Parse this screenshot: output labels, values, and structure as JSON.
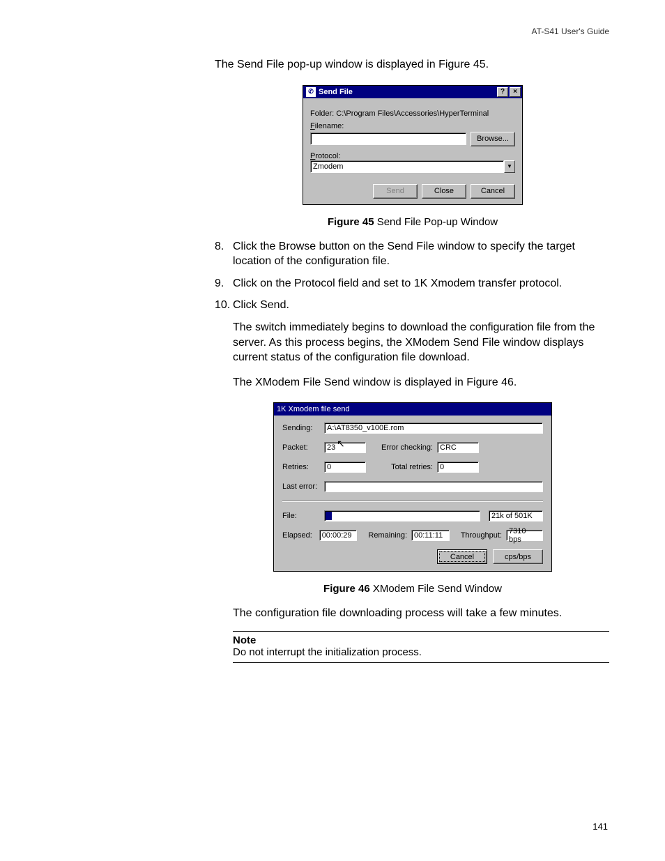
{
  "header": {
    "guide": "AT-S41 User's Guide"
  },
  "intro1": "The Send File pop-up window is displayed in Figure 45.",
  "sendfile": {
    "title": "Send File",
    "help_glyph": "?",
    "close_glyph": "×",
    "folder_label_prefix": "Folder: ",
    "folder_path": "C:\\Program Files\\Accessories\\HyperTerminal",
    "filename_label": "Filename:",
    "filename_value": "",
    "browse_label": "Browse...",
    "protocol_label": "Protocol:",
    "protocol_value": "Zmodem",
    "send_label": "Send",
    "close_label": "Close",
    "cancel_label": "Cancel"
  },
  "fig45": {
    "label": "Figure 45",
    "caption": "  Send File Pop-up Window"
  },
  "steps": {
    "s8_num": "8.",
    "s8": "Click the Browse button on the Send File window to specify the target location of the configuration file.",
    "s9_num": "9.",
    "s9": "Click on the Protocol field and set to 1K Xmodem transfer protocol.",
    "s10_num": "10.",
    "s10": "Click Send.",
    "after10a": "The switch immediately begins to download the configuration file from the server. As this process begins, the XModem Send File window displays current status of the configuration file download.",
    "after10b": "The XModem File Send window is displayed in Figure 46."
  },
  "xmodem": {
    "title": "1K Xmodem file send",
    "sending_label": "Sending:",
    "sending_value": "A:\\AT8350_v100E.rom",
    "packet_label": "Packet:",
    "packet_value": "23",
    "errchk_label": "Error checking:",
    "errchk_value": "CRC",
    "retries_label": "Retries:",
    "retries_value": "0",
    "totretries_label": "Total retries:",
    "totretries_value": "0",
    "lasterr_label": "Last error:",
    "lasterr_value": "",
    "file_label": "File:",
    "file_progress_text": "21k of 501K",
    "file_progress_pct": 4,
    "elapsed_label": "Elapsed:",
    "elapsed_value": "00:00:29",
    "remaining_label": "Remaining:",
    "remaining_value": "00:11:11",
    "throughput_label": "Throughput:",
    "throughput_value": "7310 bps",
    "cancel_label": "Cancel",
    "cpsbps_label": "cps/bps"
  },
  "fig46": {
    "label": "Figure 46",
    "caption": "  XModem File Send Window"
  },
  "after_fig46": "The configuration file downloading process will take a few minutes.",
  "note": {
    "title": "Note",
    "text": "Do not interrupt the initialization process."
  },
  "page_number": "141"
}
